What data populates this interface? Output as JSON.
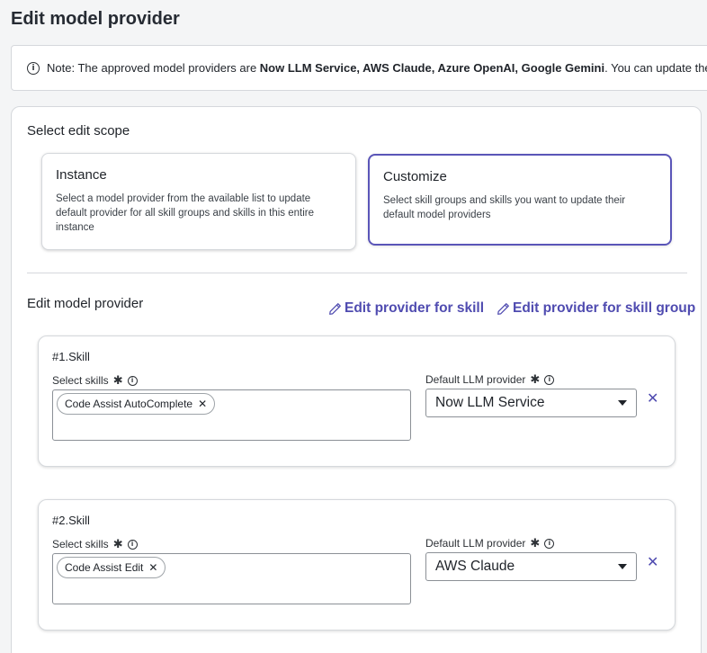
{
  "page_title": "Edit model provider",
  "note": {
    "prefix": "Note: The approved model providers are ",
    "providers": "Now LLM Service, AWS Claude, Azure OpenAI, Google Gemini",
    "suffix": ". You can update the defa"
  },
  "scope": {
    "title": "Select edit scope",
    "instance": {
      "title": "Instance",
      "description": "Select a model provider from the available list to update default provider for all skill groups and skills in this entire instance"
    },
    "customize": {
      "title": "Customize",
      "description": "Select skill groups and skills you want to update their default model providers"
    }
  },
  "edit_section": {
    "title": "Edit model provider",
    "edit_skill_link": "Edit provider for skill",
    "edit_group_link": "Edit provider for skill group"
  },
  "skills": [
    {
      "number": "#1.Skill",
      "skills_label": "Select skills",
      "chips": [
        "Code Assist AutoComplete"
      ],
      "provider_label": "Default LLM provider",
      "provider_value": "Now LLM Service"
    },
    {
      "number": "#2.Skill",
      "skills_label": "Select skills",
      "chips": [
        "Code Assist Edit"
      ],
      "provider_label": "Default LLM provider",
      "provider_value": "AWS Claude"
    }
  ],
  "colors": {
    "accent": "#4f4bb0",
    "selected_border": "#5a55b8",
    "background": "#f4f5f6"
  },
  "icons": {
    "info": "info-icon",
    "pencil": "pencil-icon",
    "close": "close-icon",
    "dropdown": "chevron-down-icon",
    "required": "asterisk-icon"
  }
}
